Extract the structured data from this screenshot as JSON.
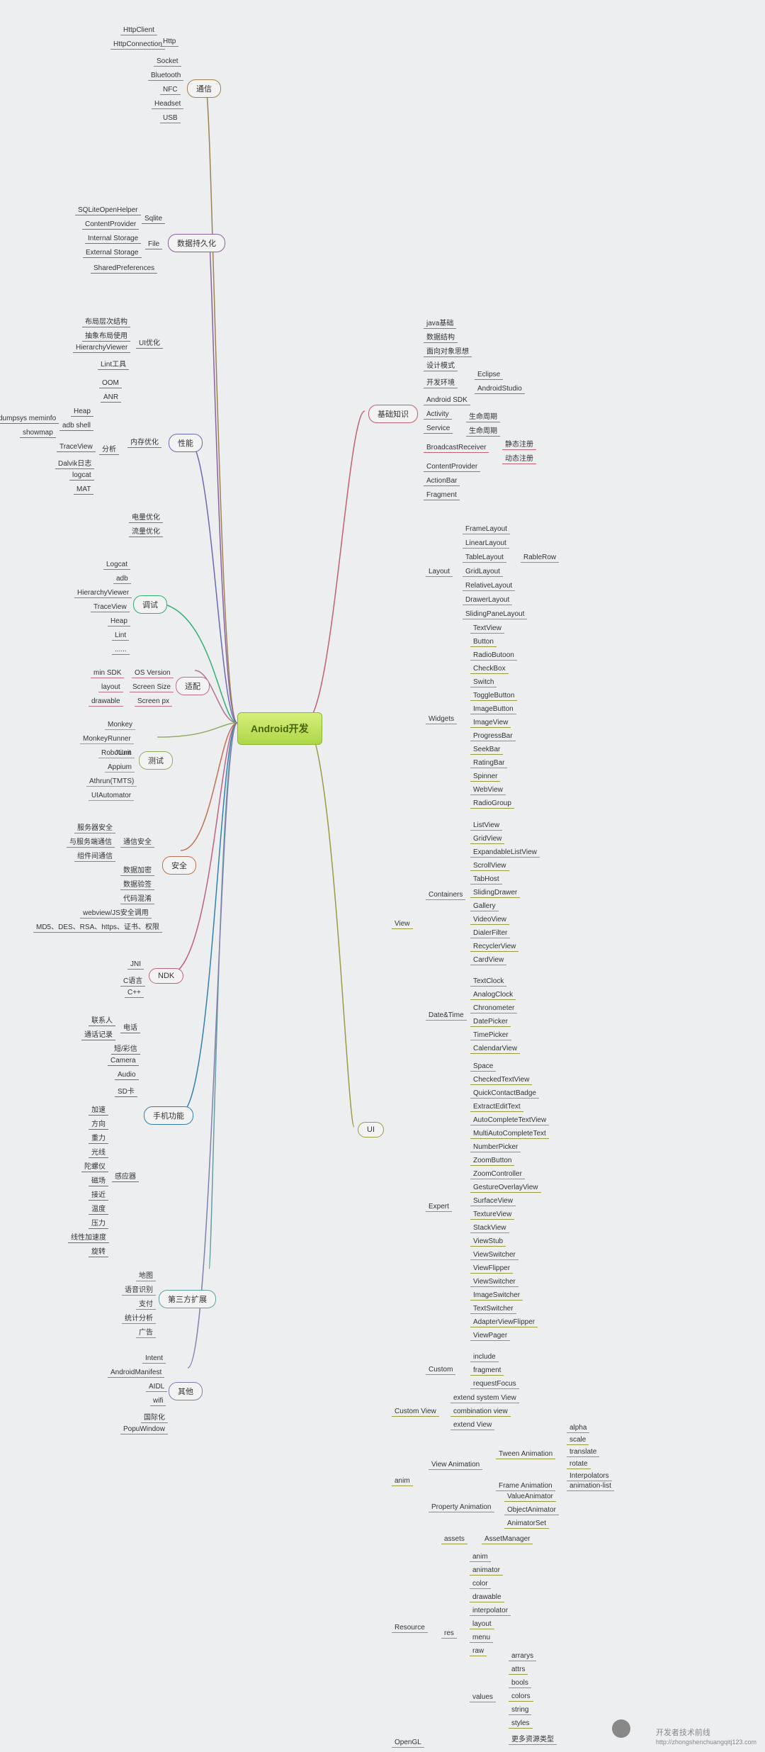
{
  "root": "Android开发",
  "通信": {
    "t": "通信",
    "children": {
      "Http": {
        "t": "Http",
        "children": [
          "HttpClient",
          "HttpConnection"
        ]
      },
      "Socket": "Socket",
      "Bluetooth": "Bluetooth",
      "NFC": "NFC",
      "Headset": "Headset",
      "USB": "USB"
    }
  },
  "数据持久化": {
    "t": "数据持久化",
    "children": {
      "Sqlite": {
        "t": "Sqlite",
        "children": [
          "SQLiteOpenHelper",
          "ContentProvider"
        ]
      },
      "File": {
        "t": "File",
        "children": [
          "Internal Storage",
          "External Storage"
        ]
      },
      "SharedPreferences": "SharedPreferences"
    }
  },
  "性能": {
    "t": "性能",
    "children": {
      "UI优化": {
        "t": "UI优化",
        "children": [
          "布局层次结构",
          "抽象布局使用",
          "HierarchyViewer",
          "Lint工具"
        ]
      },
      "内存优化": {
        "t": "内存优化",
        "children": {
          "OOM": "OOM",
          "ANR": "ANR",
          "分析": {
            "t": "分析",
            "children": {
              "Heap": "Heap",
              "adbshell": {
                "t": "adb shell",
                "children": [
                  "dumpsys meminfo",
                  "showmap"
                ]
              },
              "TraceView": "TraceView",
              "Dalvik日志": "Dalvik日志",
              "logcat": "logcat",
              "MAT": "MAT"
            }
          }
        }
      },
      "电量优化": "电量优化",
      "流量优化": "流量优化"
    }
  },
  "基础知识": {
    "t": "基础知识",
    "children": {
      "java基础": "java基础",
      "数据结构": "数据结构",
      "面向对象思想": "面向对象思想",
      "设计模式": "设计模式",
      "开发环境": {
        "t": "开发环境",
        "children": [
          "Eclipse",
          "AndroidStudio"
        ]
      },
      "AndroidSDK": "Android SDK",
      "Activity": {
        "t": "Activity",
        "children": [
          "生命周期"
        ]
      },
      "Service": {
        "t": "Service",
        "children": [
          "生命周期"
        ]
      },
      "BroadcastReceiver": {
        "t": "BroadcastReceiver",
        "children": [
          "静态注册",
          "动态注册"
        ]
      },
      "ContentProvider": "ContentProvider",
      "ActionBar": "ActionBar",
      "Fragment": "Fragment"
    }
  },
  "调试": {
    "t": "调试",
    "children": [
      "Logcat",
      "adb",
      "HierarchyViewer",
      "TraceView",
      "Heap",
      "Lint",
      "......"
    ]
  },
  "适配": {
    "t": "适配",
    "children": {
      "OSVersion": {
        "t": "OS Version",
        "children": [
          "min SDK"
        ]
      },
      "ScreenSize": {
        "t": "Screen Size",
        "children": [
          "layout"
        ]
      },
      "Screenpx": {
        "t": "Screen px",
        "children": [
          "drawable"
        ]
      }
    }
  },
  "测试": {
    "t": "测试",
    "children": [
      "Monkey",
      "MonkeyRunner",
      "JUnit",
      "Appium",
      "Athrun(TMTS)",
      "UIAutomator",
      "Robotium"
    ]
  },
  "安全": {
    "t": "安全",
    "children": {
      "通信安全": {
        "t": "通信安全",
        "children": [
          "服务器安全",
          "与服务端通信",
          "组件间通信"
        ]
      },
      "数据加密": "数据加密",
      "数据验签": "数据验签",
      "代码混淆": "代码混淆",
      "webviewjs": "webview/JS安全调用",
      "crypto": "MD5、DES、RSA、https、证书、权限"
    }
  },
  "NDK": {
    "t": "NDK",
    "children": [
      "JNI",
      "C语言",
      "C++"
    ]
  },
  "手机功能": {
    "t": "手机功能",
    "children": {
      "电话": {
        "t": "电话",
        "children": [
          "联系人",
          "通话记录"
        ]
      },
      "短彩信": "短/彩信",
      "Camera": "Camera",
      "Audio": "Audio",
      "SD卡": "SD卡",
      "感应器": {
        "t": "感应器",
        "children": [
          "加速",
          "方向",
          "重力",
          "光线",
          "陀螺仪",
          "磁场",
          "接近",
          "温度",
          "压力",
          "线性加速度",
          "旋转"
        ]
      }
    }
  },
  "第三方扩展": {
    "t": "第三方扩展",
    "children": [
      "地图",
      "语音识别",
      "支付",
      "统计分析",
      "广告"
    ]
  },
  "其他": {
    "t": "其他",
    "children": [
      "Intent",
      "AndroidManifest",
      "AIDL",
      "wifi",
      "国际化",
      "PopuWindow"
    ]
  },
  "UI": {
    "t": "UI",
    "children": {
      "View": {
        "t": "View",
        "children": {
          "Layout": {
            "t": "Layout",
            "children": {
              "FrameLayout": "FrameLayout",
              "LinearLayout": "LinearLayout",
              "TableLayout": {
                "t": "TableLayout",
                "children": [
                  "RableRow"
                ]
              },
              "GridLayout": "GridLayout",
              "RelativeLayout": "RelativeLayout",
              "DrawerLayout": "DrawerLayout",
              "SlidingPaneLayout": "SlidingPaneLayout"
            }
          },
          "Widgets": {
            "t": "Widgets",
            "children": [
              "TextView",
              "Button",
              "RadioButoon",
              "CheckBox",
              "Switch",
              "ToggleButton",
              "ImageButton",
              "ImageView",
              "ProgressBar",
              "SeekBar",
              "RatingBar",
              "Spinner",
              "WebView",
              "RadioGroup"
            ]
          },
          "Containers": {
            "t": "Containers",
            "children": [
              "ListView",
              "GridView",
              "ExpandableListView",
              "ScrollView",
              "TabHost",
              "SlidingDrawer",
              "Gallery",
              "VideoView",
              "DialerFilter",
              "RecyclerView",
              "CardView"
            ]
          },
          "DateTime": {
            "t": "Date&Time",
            "children": [
              "TextClock",
              "AnalogClock",
              "Chronometer",
              "DatePicker",
              "TimePicker",
              "CalendarView"
            ]
          },
          "Expert": {
            "t": "Expert",
            "children": [
              "Space",
              "CheckedTextView",
              "QuickContactBadge",
              "ExtractEditText",
              "AutoCompleteTextView",
              "MultiAutoCompleteText",
              "NumberPicker",
              "ZoomButton",
              "ZoomController",
              "GestureOverlayView",
              "SurfaceView",
              "TextureView",
              "StackView",
              "ViewStub",
              "ViewSwitcher",
              "ViewFlipper",
              "ViewSwitcher",
              "ImageSwitcher",
              "TextSwitcher",
              "AdapterViewFlipper",
              "ViewPager"
            ]
          },
          "Custom": {
            "t": "Custom",
            "children": [
              "include",
              "fragment",
              "requestFocus"
            ]
          }
        }
      },
      "CustomView": {
        "t": "Custom View",
        "children": [
          "extend system View",
          "combination view",
          "extend View"
        ]
      },
      "anim": {
        "t": "anim",
        "children": {
          "ViewAnimation": {
            "t": "View Animation",
            "children": {
              "TweenAnimation": {
                "t": "Tween Animation",
                "children": [
                  "alpha",
                  "scale",
                  "translate",
                  "rotate",
                  "Interpolators"
                ]
              },
              "FrameAnimation": {
                "t": "Frame Animation",
                "children": [
                  "animation-list"
                ]
              }
            }
          },
          "PropertyAnimation": {
            "t": "Property Animation",
            "children": [
              "ValueAnimator",
              "ObjectAnimator",
              "AnimatorSet"
            ]
          }
        }
      },
      "Resource": {
        "t": "Resource",
        "children": {
          "assets": {
            "t": "assets",
            "children": [
              "AssetManager"
            ]
          },
          "res": {
            "t": "res",
            "children": {
              "anim": "anim",
              "animator": "animator",
              "color": "color",
              "drawable": "drawable",
              "interpolator": "interpolator",
              "layout": "layout",
              "menu": "menu",
              "raw": "raw",
              "values": {
                "t": "values",
                "children": [
                  "arrarys",
                  "attrs",
                  "bools",
                  "colors",
                  "string",
                  "styles",
                  "更多资源类型"
                ]
              }
            }
          }
        }
      },
      "OpenGL": "OpenGL"
    }
  },
  "watermark": {
    "name": "开发者技术前线",
    "url": "http://zhongshenchuangqitj123.com"
  }
}
